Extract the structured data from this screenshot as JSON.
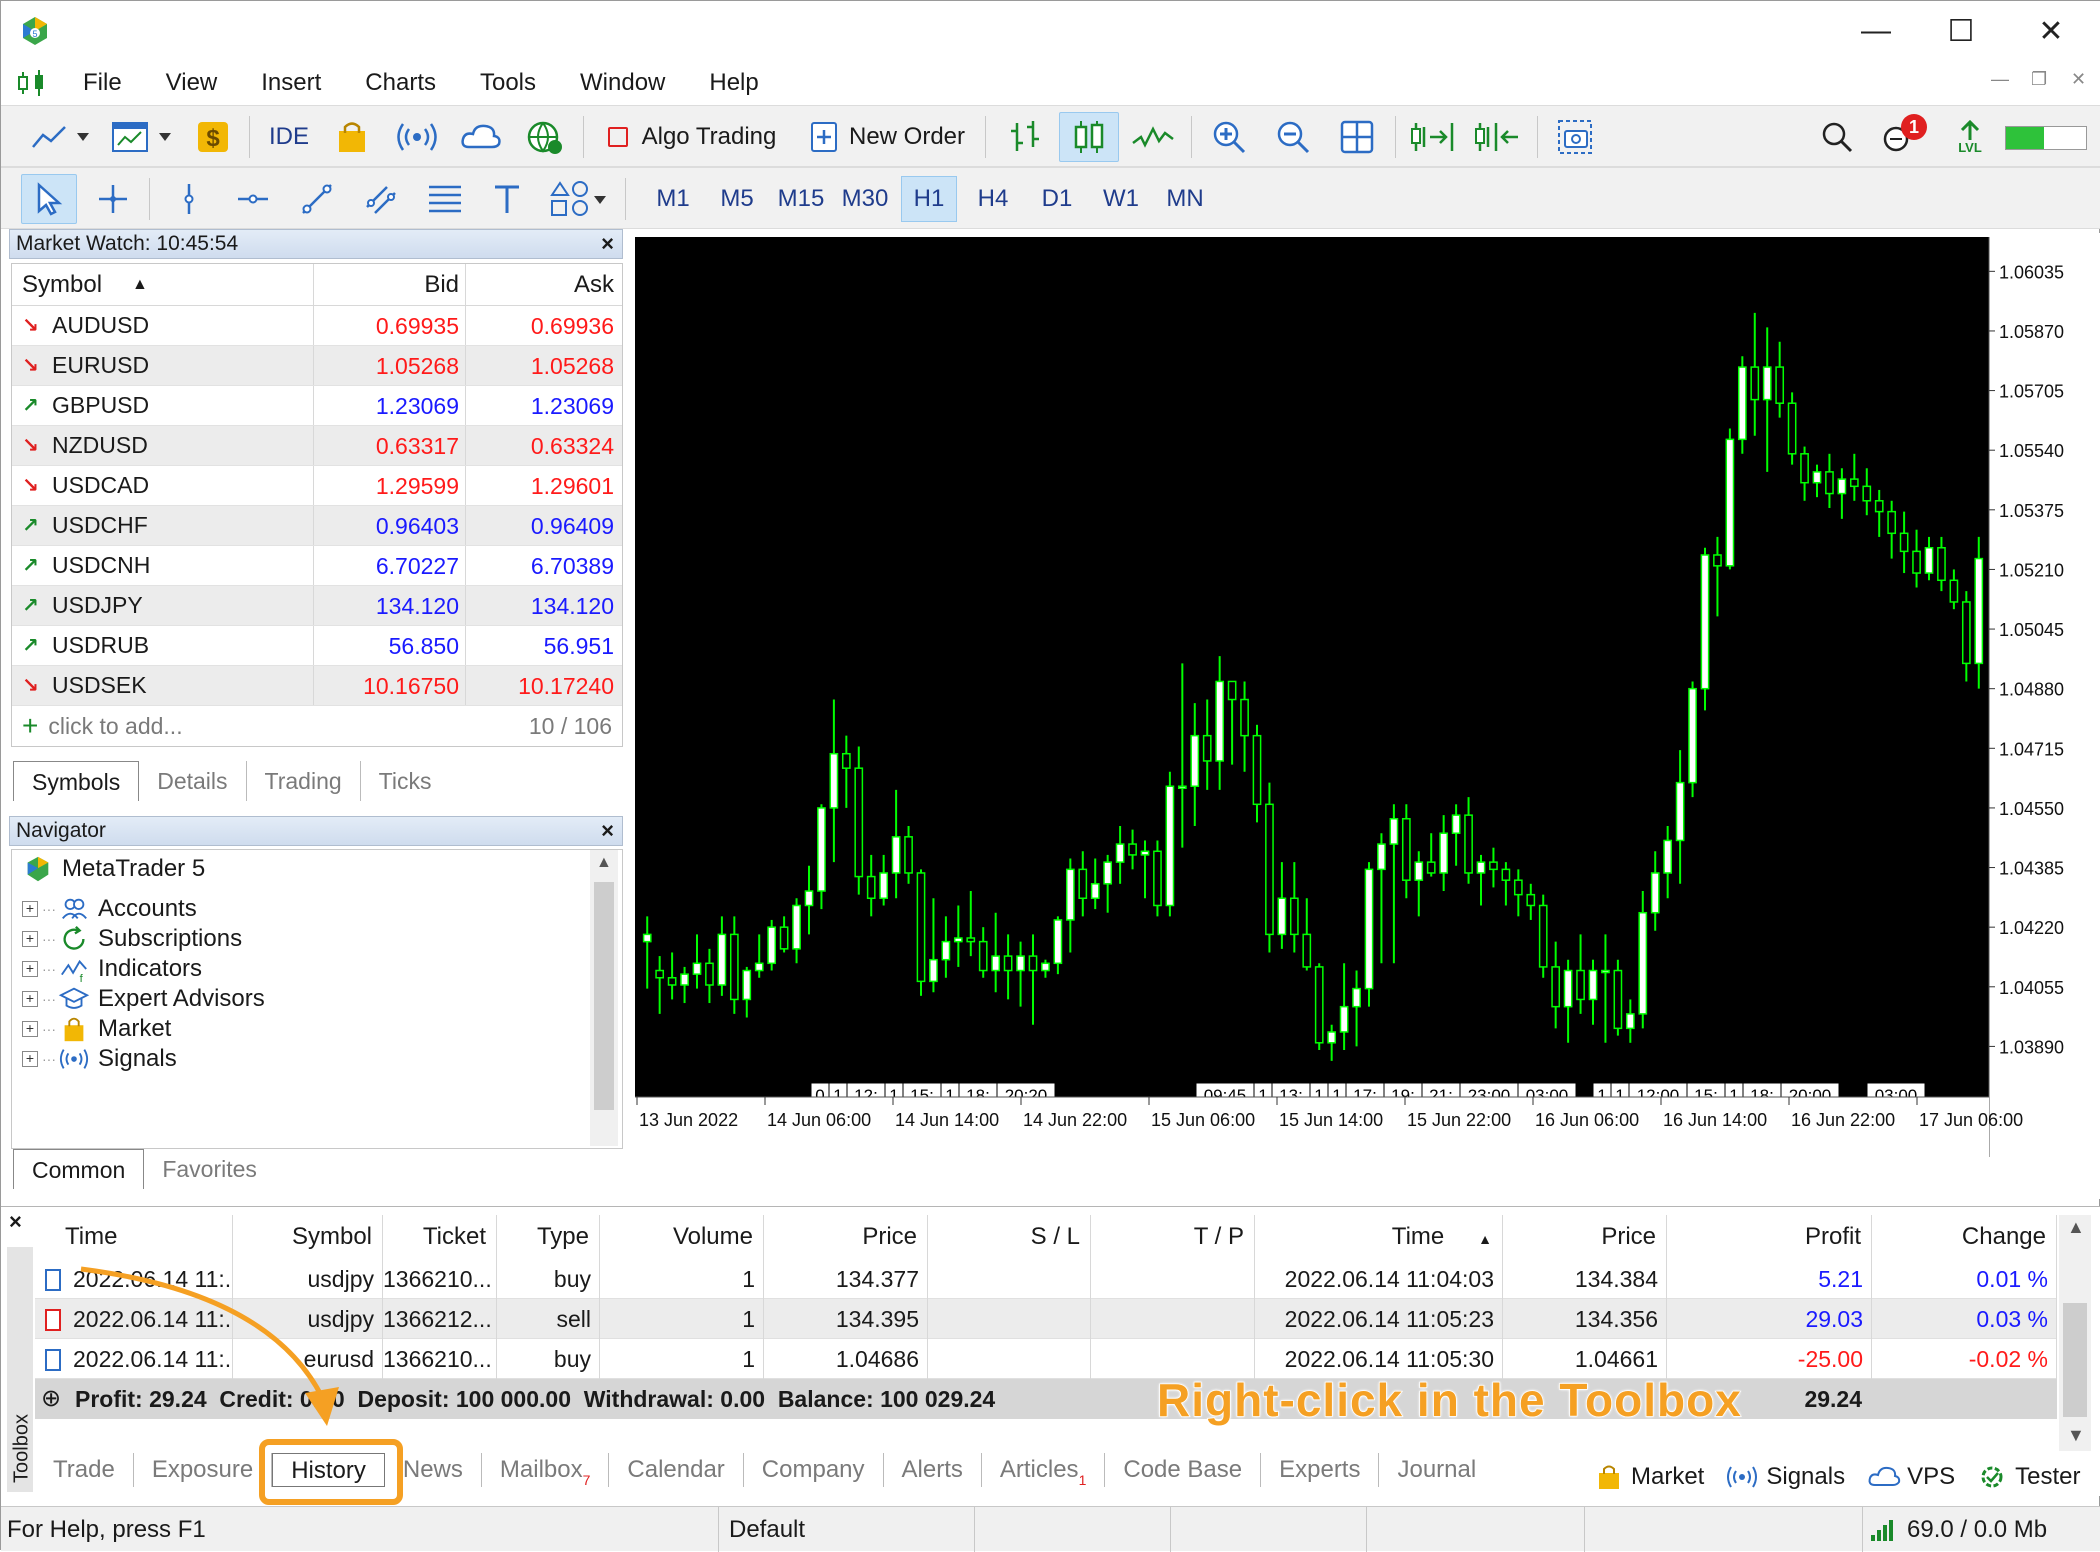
{
  "window": {
    "title": "",
    "minimize": "—",
    "maximize": "☐",
    "close": "✕"
  },
  "menu": [
    "File",
    "View",
    "Insert",
    "Charts",
    "Tools",
    "Window",
    "Help"
  ],
  "toolbar": {
    "ide_label": "IDE",
    "algo_trading_label": "Algo Trading",
    "new_order_label": "New Order",
    "notification_count": "1",
    "lvl_label": "LVL"
  },
  "timeframes": [
    "M1",
    "M5",
    "M15",
    "M30",
    "H1",
    "H4",
    "D1",
    "W1",
    "MN"
  ],
  "active_timeframe": "H1",
  "market_watch": {
    "title": "Market Watch: 10:45:54",
    "columns": [
      "Symbol",
      "Bid",
      "Ask"
    ],
    "rows": [
      {
        "symbol": "AUDUSD",
        "dir": "down",
        "bid": "0.69935",
        "ask": "0.69936"
      },
      {
        "symbol": "EURUSD",
        "dir": "down",
        "bid": "1.05268",
        "ask": "1.05268"
      },
      {
        "symbol": "GBPUSD",
        "dir": "up",
        "bid": "1.23069",
        "ask": "1.23069"
      },
      {
        "symbol": "NZDUSD",
        "dir": "down",
        "bid": "0.63317",
        "ask": "0.63324"
      },
      {
        "symbol": "USDCAD",
        "dir": "down",
        "bid": "1.29599",
        "ask": "1.29601"
      },
      {
        "symbol": "USDCHF",
        "dir": "up",
        "bid": "0.96403",
        "ask": "0.96409"
      },
      {
        "symbol": "USDCNH",
        "dir": "up",
        "bid": "6.70227",
        "ask": "6.70389"
      },
      {
        "symbol": "USDJPY",
        "dir": "up",
        "bid": "134.120",
        "ask": "134.120"
      },
      {
        "symbol": "USDRUB",
        "dir": "up",
        "bid": "56.850",
        "ask": "56.951"
      },
      {
        "symbol": "USDSEK",
        "dir": "down",
        "bid": "10.16750",
        "ask": "10.17240"
      }
    ],
    "add_label": "click to add...",
    "count": "10 / 106",
    "tabs": [
      "Symbols",
      "Details",
      "Trading",
      "Ticks"
    ]
  },
  "navigator": {
    "title": "Navigator",
    "root": "MetaTrader 5",
    "items": [
      "Accounts",
      "Subscriptions",
      "Indicators",
      "Expert Advisors",
      "Market",
      "Signals"
    ],
    "tabs": [
      "Common",
      "Favorites"
    ]
  },
  "chart": {
    "price_labels": [
      "1.06035",
      "1.05870",
      "1.05705",
      "1.05540",
      "1.05375",
      "1.05210",
      "1.05045",
      "1.04880",
      "1.04715",
      "1.04550",
      "1.04385",
      "1.04220",
      "1.04055",
      "1.03890"
    ],
    "time_labels": [
      "13 Jun 2022",
      "14 Jun 06:00",
      "14 Jun 14:00",
      "14 Jun 22:00",
      "15 Jun 06:00",
      "15 Jun 14:00",
      "15 Jun 22:00",
      "16 Jun 06:00",
      "16 Jun 14:00",
      "16 Jun 22:00",
      "17 Jun 06:00"
    ],
    "event_groups": [
      {
        "labels": [
          "0",
          "1",
          "12:",
          "1",
          "15:",
          "1",
          "18:",
          "20:20"
        ]
      },
      {
        "labels": [
          "09:45",
          "1",
          "13:",
          "1",
          "1",
          "17:",
          "19:",
          "21:",
          "23:00",
          "03:00"
        ]
      },
      {
        "labels": [
          "1",
          "1",
          "12:00",
          "15:",
          "1",
          "18:",
          "20:00"
        ]
      },
      {
        "labels": [
          "03:00"
        ]
      }
    ]
  },
  "chart_data": {
    "type": "candlestick",
    "symbol": "EURUSD",
    "timeframe": "H1",
    "ylim": [
      1.0375,
      1.0613
    ],
    "candles": [
      [
        1.0418,
        1.0425,
        1.0405,
        1.042
      ],
      [
        1.041,
        1.0414,
        1.0398,
        1.0408
      ],
      [
        1.0408,
        1.0415,
        1.0402,
        1.0406
      ],
      [
        1.0406,
        1.0411,
        1.0401,
        1.0409
      ],
      [
        1.0409,
        1.042,
        1.0405,
        1.0412
      ],
      [
        1.0412,
        1.0416,
        1.0401,
        1.0406
      ],
      [
        1.0406,
        1.0425,
        1.0403,
        1.042
      ],
      [
        1.042,
        1.0425,
        1.0398,
        1.0402
      ],
      [
        1.0402,
        1.0411,
        1.0397,
        1.041
      ],
      [
        1.041,
        1.042,
        1.0408,
        1.0412
      ],
      [
        1.0412,
        1.0424,
        1.041,
        1.0422
      ],
      [
        1.0422,
        1.0425,
        1.0415,
        1.0416
      ],
      [
        1.0416,
        1.043,
        1.0412,
        1.0428
      ],
      [
        1.0428,
        1.0439,
        1.042,
        1.0432
      ],
      [
        1.0432,
        1.0456,
        1.0427,
        1.0455
      ],
      [
        1.0455,
        1.0485,
        1.044,
        1.047
      ],
      [
        1.047,
        1.0475,
        1.0455,
        1.0466
      ],
      [
        1.0466,
        1.0472,
        1.0431,
        1.0436
      ],
      [
        1.0436,
        1.0442,
        1.0425,
        1.043
      ],
      [
        1.043,
        1.0442,
        1.0428,
        1.0437
      ],
      [
        1.0437,
        1.046,
        1.043,
        1.0447
      ],
      [
        1.0447,
        1.045,
        1.0434,
        1.0437
      ],
      [
        1.0437,
        1.0438,
        1.0403,
        1.0407
      ],
      [
        1.0407,
        1.043,
        1.0404,
        1.0413
      ],
      [
        1.0413,
        1.0425,
        1.0408,
        1.0418
      ],
      [
        1.0418,
        1.0428,
        1.0411,
        1.0419
      ],
      [
        1.0419,
        1.0432,
        1.0414,
        1.0418
      ],
      [
        1.0418,
        1.0422,
        1.0408,
        1.041
      ],
      [
        1.041,
        1.0426,
        1.0404,
        1.0414
      ],
      [
        1.0414,
        1.042,
        1.0402,
        1.041
      ],
      [
        1.041,
        1.0418,
        1.04,
        1.0414
      ],
      [
        1.0414,
        1.042,
        1.0395,
        1.041
      ],
      [
        1.041,
        1.0413,
        1.0408,
        1.0412
      ],
      [
        1.0412,
        1.0425,
        1.0409,
        1.0424
      ],
      [
        1.0424,
        1.0441,
        1.0415,
        1.0438
      ],
      [
        1.0438,
        1.0443,
        1.0425,
        1.043
      ],
      [
        1.043,
        1.0441,
        1.0427,
        1.0434
      ],
      [
        1.0434,
        1.0442,
        1.0426,
        1.044
      ],
      [
        1.044,
        1.045,
        1.0434,
        1.0445
      ],
      [
        1.0445,
        1.0449,
        1.0438,
        1.0442
      ],
      [
        1.0442,
        1.0446,
        1.043,
        1.0443
      ],
      [
        1.0443,
        1.0446,
        1.0425,
        1.0428
      ],
      [
        1.0428,
        1.0465,
        1.0425,
        1.0461
      ],
      [
        1.0461,
        1.0495,
        1.0444,
        1.0461
      ],
      [
        1.0461,
        1.0484,
        1.045,
        1.0475
      ],
      [
        1.0475,
        1.0485,
        1.046,
        1.0468
      ],
      [
        1.0468,
        1.0497,
        1.046,
        1.049
      ],
      [
        1.049,
        1.0488,
        1.0467,
        1.0485
      ],
      [
        1.0485,
        1.049,
        1.0465,
        1.0475
      ],
      [
        1.0475,
        1.0478,
        1.0451,
        1.0456
      ],
      [
        1.0456,
        1.0462,
        1.0415,
        1.042
      ],
      [
        1.042,
        1.044,
        1.0416,
        1.043
      ],
      [
        1.043,
        1.044,
        1.0415,
        1.042
      ],
      [
        1.042,
        1.043,
        1.041,
        1.0411
      ],
      [
        1.0411,
        1.0412,
        1.0388,
        1.039
      ],
      [
        1.039,
        1.0395,
        1.0385,
        1.0393
      ],
      [
        1.0393,
        1.0412,
        1.0388,
        1.04
      ],
      [
        1.04,
        1.041,
        1.0389,
        1.0405
      ],
      [
        1.0405,
        1.044,
        1.04,
        1.0438
      ],
      [
        1.0438,
        1.0448,
        1.0412,
        1.0445
      ],
      [
        1.0445,
        1.0456,
        1.0412,
        1.0452
      ],
      [
        1.0452,
        1.0456,
        1.043,
        1.0435
      ],
      [
        1.0435,
        1.0443,
        1.0425,
        1.044
      ],
      [
        1.044,
        1.0448,
        1.0436,
        1.0437
      ],
      [
        1.0437,
        1.0453,
        1.0432,
        1.0448
      ],
      [
        1.0448,
        1.0456,
        1.0439,
        1.0453
      ],
      [
        1.0453,
        1.0458,
        1.0434,
        1.0437
      ],
      [
        1.0437,
        1.0442,
        1.0428,
        1.044
      ],
      [
        1.044,
        1.0444,
        1.0433,
        1.0438
      ],
      [
        1.0438,
        1.044,
        1.0428,
        1.0435
      ],
      [
        1.0435,
        1.0438,
        1.0425,
        1.0431
      ],
      [
        1.0431,
        1.0434,
        1.0424,
        1.0428
      ],
      [
        1.0428,
        1.0431,
        1.0408,
        1.0411
      ],
      [
        1.0411,
        1.0418,
        1.0394,
        1.04
      ],
      [
        1.04,
        1.0413,
        1.039,
        1.041
      ],
      [
        1.041,
        1.042,
        1.0398,
        1.0402
      ],
      [
        1.0402,
        1.0413,
        1.0395,
        1.041
      ],
      [
        1.041,
        1.042,
        1.039,
        1.041
      ],
      [
        1.041,
        1.0413,
        1.0392,
        1.0394
      ],
      [
        1.0394,
        1.0402,
        1.039,
        1.0398
      ],
      [
        1.0398,
        1.0432,
        1.0394,
        1.0426
      ],
      [
        1.0426,
        1.0443,
        1.0421,
        1.0437
      ],
      [
        1.0437,
        1.045,
        1.043,
        1.0446
      ],
      [
        1.0446,
        1.0471,
        1.0434,
        1.0462
      ],
      [
        1.0462,
        1.049,
        1.0458,
        1.0488
      ],
      [
        1.0488,
        1.0527,
        1.0482,
        1.0525
      ],
      [
        1.0525,
        1.053,
        1.0508,
        1.0522
      ],
      [
        1.0522,
        1.056,
        1.0521,
        1.0557
      ],
      [
        1.0557,
        1.058,
        1.0553,
        1.0577
      ],
      [
        1.0577,
        1.0592,
        1.0558,
        1.0568
      ],
      [
        1.0568,
        1.0588,
        1.0548,
        1.0577
      ],
      [
        1.0577,
        1.0584,
        1.0563,
        1.0567
      ],
      [
        1.0567,
        1.057,
        1.055,
        1.0553
      ],
      [
        1.0553,
        1.0555,
        1.054,
        1.0545
      ],
      [
        1.0545,
        1.055,
        1.0541,
        1.0548
      ],
      [
        1.0548,
        1.0553,
        1.0538,
        1.0542
      ],
      [
        1.0542,
        1.0549,
        1.0535,
        1.0546
      ],
      [
        1.0546,
        1.0553,
        1.054,
        1.0544
      ],
      [
        1.0544,
        1.0549,
        1.0536,
        1.054
      ],
      [
        1.054,
        1.0543,
        1.053,
        1.0537
      ],
      [
        1.0537,
        1.054,
        1.0524,
        1.0531
      ],
      [
        1.0531,
        1.0537,
        1.052,
        1.0526
      ],
      [
        1.0526,
        1.0532,
        1.0516,
        1.052
      ],
      [
        1.052,
        1.053,
        1.0518,
        1.0527
      ],
      [
        1.0527,
        1.053,
        1.0515,
        1.0518
      ],
      [
        1.0518,
        1.0521,
        1.051,
        1.0512
      ],
      [
        1.0512,
        1.0515,
        1.049,
        1.0495
      ],
      [
        1.0495,
        1.053,
        1.0488,
        1.0524
      ]
    ]
  },
  "toolbox": {
    "columns": [
      "Time",
      "Symbol",
      "Ticket",
      "Type",
      "Volume",
      "Price",
      "S / L",
      "T / P",
      "Time",
      "Price",
      "Profit",
      "Change"
    ],
    "rows": [
      {
        "time": "2022.06.14 11:...",
        "symbol": "usdjpy",
        "ticket": "1366210...",
        "type": "buy",
        "volume": "1",
        "price": "134.377",
        "sl": "",
        "tp": "",
        "time2": "2022.06.14 11:04:03",
        "price2": "134.384",
        "profit": "5.21",
        "change": "0.01 %"
      },
      {
        "time": "2022.06.14 11:...",
        "symbol": "usdjpy",
        "ticket": "1366212...",
        "type": "sell",
        "volume": "1",
        "price": "134.395",
        "sl": "",
        "tp": "",
        "time2": "2022.06.14 11:05:23",
        "price2": "134.356",
        "profit": "29.03",
        "change": "0.03 %"
      },
      {
        "time": "2022.06.14 11:...",
        "symbol": "eurusd",
        "ticket": "1366210...",
        "type": "buy",
        "volume": "1",
        "price": "1.04686",
        "sl": "",
        "tp": "",
        "time2": "2022.06.14 11:05:30",
        "price2": "1.04661",
        "profit": "-25.00",
        "change": "-0.02 %"
      }
    ],
    "summary": "Profit: 29.24  Credit: 0.00  Deposit: 100 000.00  Withdrawal: 0.00  Balance: 100 029.24",
    "summary_profit": "29.24",
    "side_label": "Toolbox",
    "tabs": [
      "Trade",
      "Exposure",
      "History",
      "News",
      "Mailbox",
      "Calendar",
      "Company",
      "Alerts",
      "Articles",
      "Code Base",
      "Experts",
      "Journal"
    ],
    "mailbox_sub": "7",
    "articles_sub": "1",
    "right_links": [
      "Market",
      "Signals",
      "VPS",
      "Tester"
    ]
  },
  "status": {
    "help": "For Help, press F1",
    "profile": "Default",
    "traffic": "69.0 / 0.0 Mb"
  },
  "annotation": {
    "callout": "Right-click in the Toolbox",
    "color": "#f5a023"
  },
  "colors": {
    "bull": "#ffffff",
    "bear": "#000000",
    "candle_outline": "#00ff00",
    "chart_bg": "#000000",
    "active_blue": "#cce4f7"
  }
}
